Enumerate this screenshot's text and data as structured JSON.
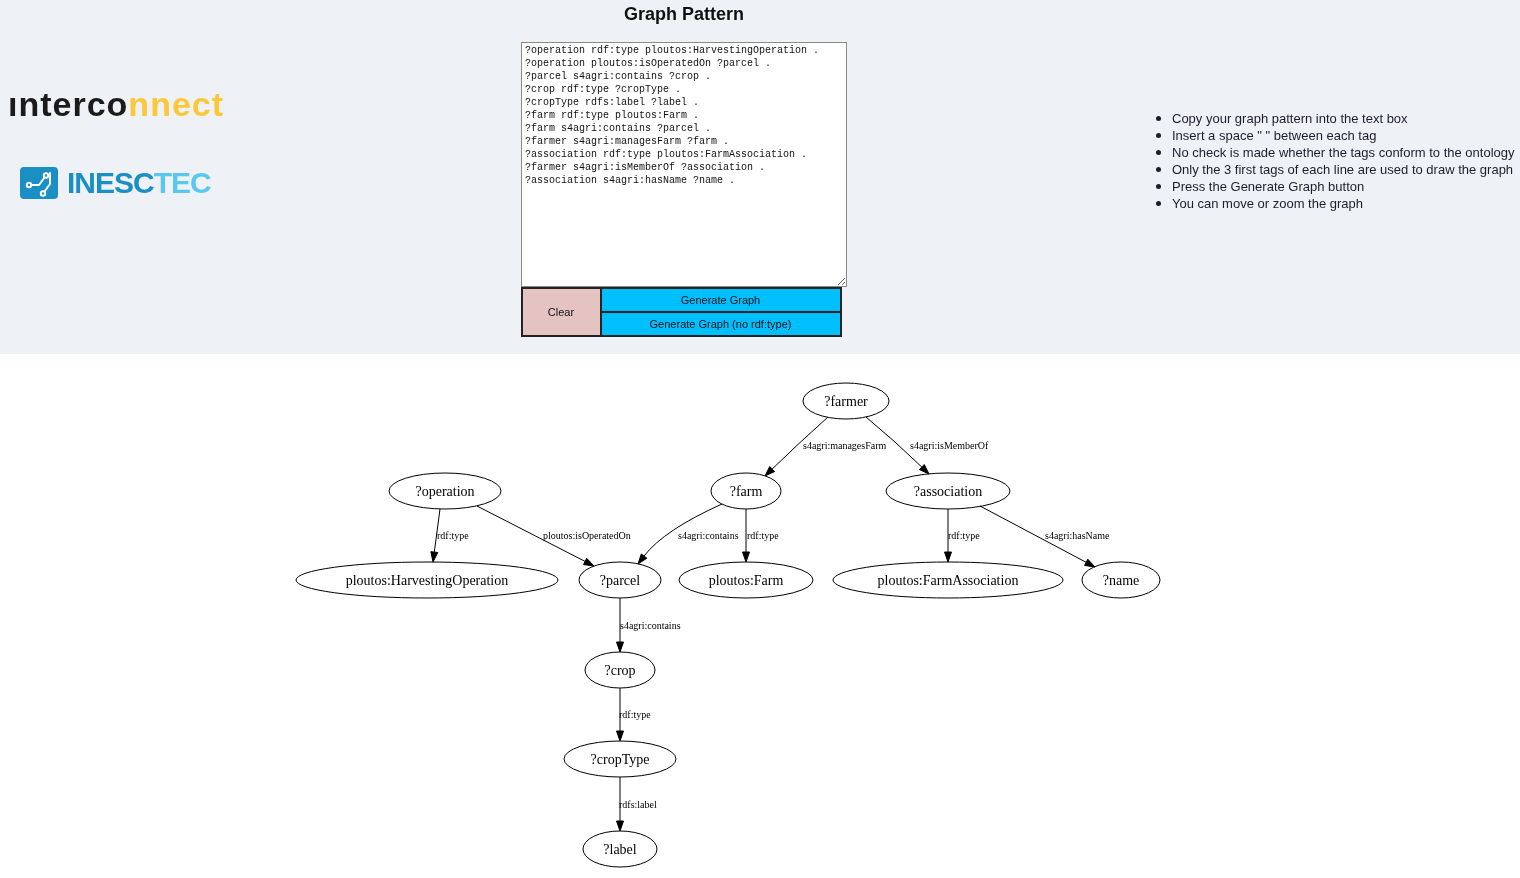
{
  "title": "Graph Pattern",
  "logos": [
    {
      "kind": "wordmark",
      "parts": [
        {
          "text": "ınterco",
          "color": "#1b1b1b"
        },
        {
          "text": "nnect",
          "color": "#fcc83a"
        }
      ]
    },
    {
      "kind": "icon_wordmark",
      "parts": [
        {
          "text": "INESC",
          "color": "#1a8fc4"
        },
        {
          "text": "TEC",
          "color": "#5ac8ee"
        }
      ]
    }
  ],
  "pattern_field": {
    "lines": [
      "?operation rdf:type ploutos:HarvestingOperation .",
      "?operation ploutos:isOperatedOn ?parcel .",
      "?parcel s4agri:contains ?crop .",
      "?crop rdf:type ?cropType .",
      "?cropType rdfs:label ?label .",
      "?farm rdf:type ploutos:Farm .",
      "?farm s4agri:contains ?parcel .",
      "?farmer s4agri:managesFarm ?farm .",
      "?association rdf:type ploutos:FarmAssociation .",
      "?farmer s4agri:isMemberOf ?association .",
      "?association s4agri:hasName ?name ."
    ]
  },
  "buttons": [
    {
      "label": "Clear",
      "kind": "clear"
    },
    {
      "label": "Generate Graph",
      "kind": "generate"
    },
    {
      "label": "Generate Graph (no rdf:type)",
      "kind": "generate"
    }
  ],
  "instructions": [
    "Copy your graph pattern into the text box",
    "Insert a space \" \" between each tag",
    "No check is made whether the tags conform to the ontology",
    "Only the 3 first tags of each line are used to draw the graph",
    "Press the Generate Graph button",
    "You can move or zoom the graph"
  ],
  "graph": {
    "nodes": [
      {
        "label": "?farmer"
      },
      {
        "label": "?operation"
      },
      {
        "label": "?farm"
      },
      {
        "label": "?association"
      },
      {
        "label": "ploutos:HarvestingOperation"
      },
      {
        "label": "?parcel"
      },
      {
        "label": "ploutos:Farm"
      },
      {
        "label": "ploutos:FarmAssociation"
      },
      {
        "label": "?name"
      },
      {
        "label": "?crop"
      },
      {
        "label": "?cropType"
      },
      {
        "label": "?label"
      }
    ],
    "edges": [
      {
        "label": "s4agri:managesFarm"
      },
      {
        "label": "s4agri:isMemberOf"
      },
      {
        "label": "rdf:type"
      },
      {
        "label": "ploutos:isOperatedOn"
      },
      {
        "label": "s4agri:contains"
      },
      {
        "label": "rdf:type"
      },
      {
        "label": "rdf:type"
      },
      {
        "label": "s4agri:hasName"
      },
      {
        "label": "s4agri:contains"
      },
      {
        "label": "rdf:type"
      },
      {
        "label": "rdfs:label"
      }
    ]
  }
}
